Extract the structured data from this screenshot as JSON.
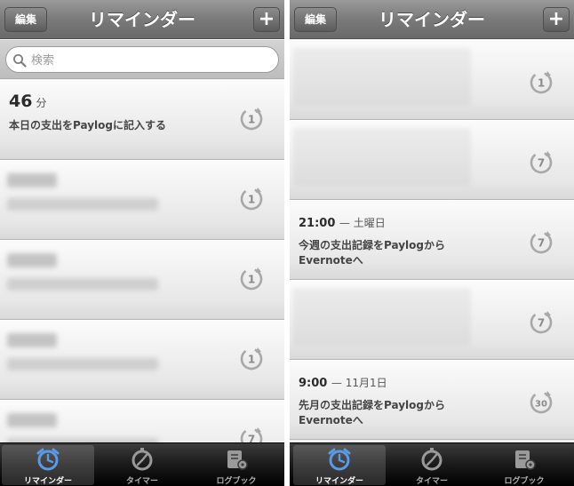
{
  "colors": {
    "accent": "#5a9ae6",
    "navbar": "#7a7a7a",
    "tabbar": "#1a1a1a",
    "cell": "#e7e7e7"
  },
  "left": {
    "nav": {
      "edit": "編集",
      "title": "リマインダー",
      "add": "+"
    },
    "search": {
      "placeholder": "検索"
    },
    "rows": [
      {
        "time": "46",
        "unit": "分",
        "text": "本日の支出をPaylogに記入する",
        "repeat": "1"
      },
      {
        "repeat": "1"
      },
      {
        "repeat": "1"
      },
      {
        "repeat": "1"
      },
      {
        "repeat": "7"
      }
    ]
  },
  "right": {
    "nav": {
      "edit": "編集",
      "title": "リマインダー",
      "add": "+"
    },
    "rows": [
      {
        "repeat": "1"
      },
      {
        "repeat": "7"
      },
      {
        "time": "21:00",
        "sub": "— 土曜日",
        "text1": "今週の支出記録をPaylogから",
        "text2": "Evernoteへ",
        "repeat": "7"
      },
      {
        "repeat": "7"
      },
      {
        "time": "9:00",
        "sub": "— 11月1日",
        "text1": "先月の支出記録をPaylogから",
        "text2": "Evernoteへ",
        "repeat": "30"
      }
    ]
  },
  "tabs": [
    {
      "label": "リマインダー",
      "icon": "alarm-clock-icon",
      "active": true
    },
    {
      "label": "タイマー",
      "icon": "stopwatch-icon",
      "active": false
    },
    {
      "label": "ログブック",
      "icon": "logbook-icon",
      "active": false
    }
  ]
}
